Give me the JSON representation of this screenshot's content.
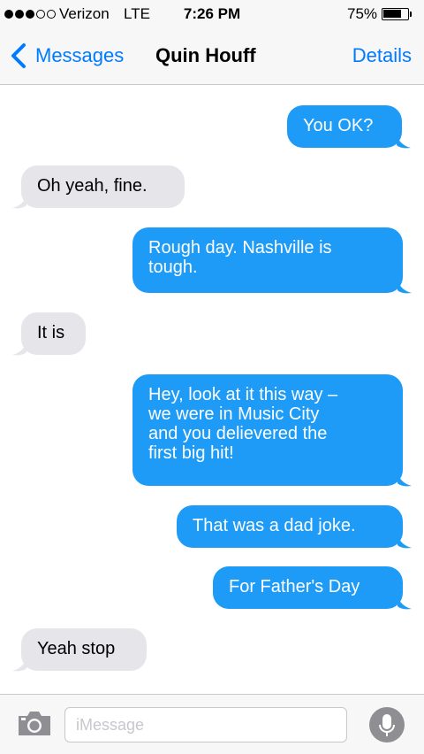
{
  "status_bar": {
    "carrier": "Verizon",
    "network": "LTE",
    "time": "7:26 PM",
    "battery": "75%",
    "battery_level": 0.75,
    "signal_bars_filled": 3,
    "signal_bars_total": 5
  },
  "nav": {
    "back_label": "Messages",
    "title": "Quin Houff",
    "details_label": "Details"
  },
  "messages": [
    {
      "direction": "outgoing",
      "lines": [
        "You OK?"
      ]
    },
    {
      "direction": "incoming",
      "lines": [
        "Oh yeah, fine."
      ]
    },
    {
      "direction": "outgoing",
      "lines": [
        "Rough day. Nashville is",
        "tough."
      ]
    },
    {
      "direction": "incoming",
      "lines": [
        "It is"
      ]
    },
    {
      "direction": "outgoing",
      "lines": [
        "Hey, look at it this way –",
        "we were in Music City",
        "and you delievered the",
        "first big hit!"
      ]
    },
    {
      "direction": "outgoing",
      "lines": [
        "That was a dad joke."
      ]
    },
    {
      "direction": "outgoing",
      "lines": [
        "For Father's Day"
      ]
    },
    {
      "direction": "incoming",
      "lines": [
        "Yeah stop"
      ]
    }
  ],
  "input": {
    "placeholder": "iMessage",
    "value": ""
  },
  "icons": {
    "back": "chevron-left-icon",
    "camera": "camera-icon",
    "mic": "microphone-icon"
  },
  "colors": {
    "accent": "#007aff",
    "outgoing_bubble": "#1d9bf6",
    "incoming_bubble": "#e5e5ea"
  }
}
